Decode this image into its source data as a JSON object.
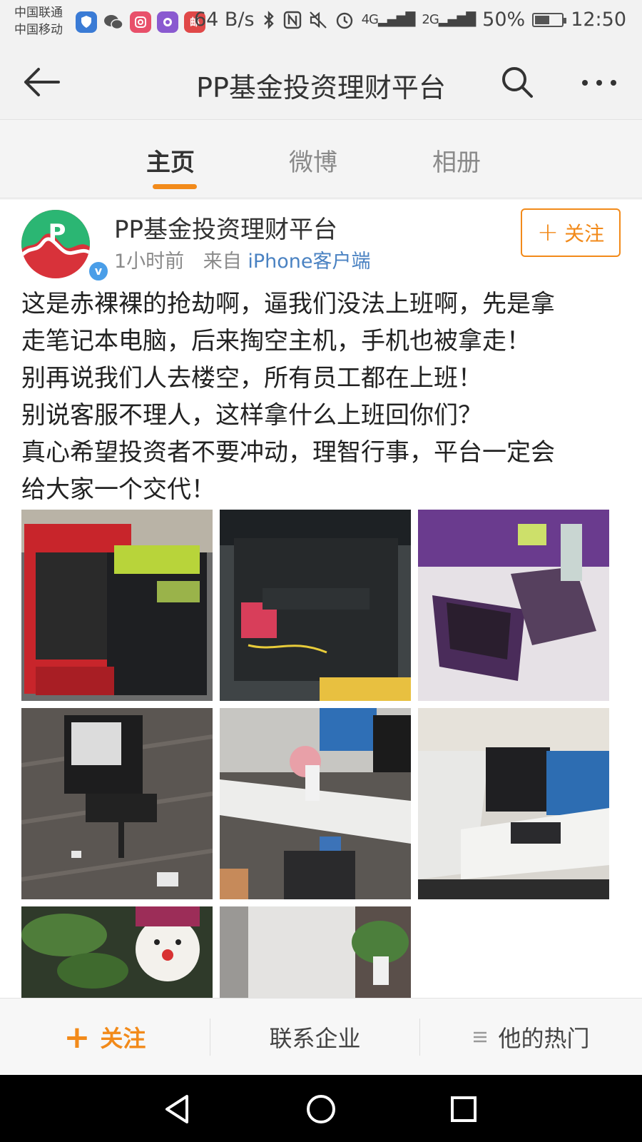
{
  "status_bar": {
    "carrier_1": "中国联通",
    "carrier_2": "中国移动",
    "network_speed": "64 B/s",
    "signal_1": "4G",
    "signal_2": "2G",
    "battery": "50%",
    "time": "12:50",
    "app_icon_text": "邮"
  },
  "nav": {
    "title": "PP基金投资理财平台"
  },
  "tabs": [
    {
      "label": "主页",
      "active": true
    },
    {
      "label": "微博",
      "active": false
    },
    {
      "label": "相册",
      "active": false
    }
  ],
  "post": {
    "avatar_text": "P",
    "author": "PP基金投资理财平台",
    "time": "1小时前",
    "from_label": "来自",
    "source": "iPhone客户端",
    "follow_label": "关注",
    "lines": [
      "这是赤裸裸的抢劫啊，逼我们没法上班啊，先是拿",
      "走笔记本电脑，后来掏空主机，手机也被拿走！",
      "别再说我们人去楼空，所有员工都在上班！",
      "别说客服不理人，这样拿什么上班回你们？",
      "真心希望投资者不要冲动，理智行事，平台一定会",
      "给大家一个交代！"
    ],
    "photos": [
      {
        "name": "photo-gutted-red-pc-case"
      },
      {
        "name": "photo-opened-pc-chassis"
      },
      {
        "name": "photo-disassembled-laptop"
      },
      {
        "name": "photo-office-chair-floor"
      },
      {
        "name": "photo-messy-desk"
      },
      {
        "name": "photo-office-workstation"
      },
      {
        "name": "photo-plant-snowman-toy"
      },
      {
        "name": "photo-office-plant"
      }
    ]
  },
  "action_bar": {
    "follow": "关注",
    "contact": "联系企业",
    "hot": "他的热门"
  },
  "colors": {
    "accent": "#f28a1a",
    "link": "#4a82c2",
    "verified": "#4a9ee8"
  }
}
